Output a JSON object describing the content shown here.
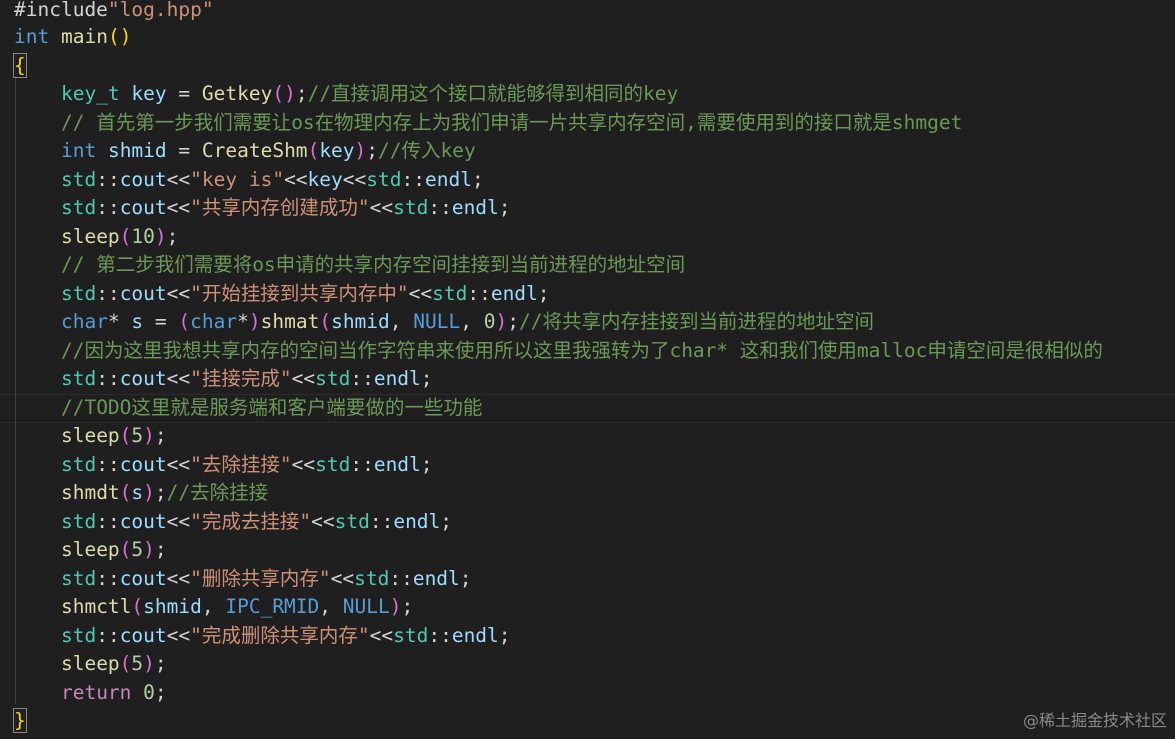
{
  "editor": {
    "lines": [
      [
        [
          "pun",
          "#include"
        ],
        [
          "str",
          "\"log.hpp\""
        ]
      ],
      [
        [
          "kw",
          "int"
        ],
        [
          "pun",
          " "
        ],
        [
          "fn",
          "main"
        ],
        [
          "brace",
          "()"
        ]
      ],
      [
        [
          "brace",
          "{"
        ]
      ],
      [],
      [
        [
          "pun",
          "    "
        ],
        [
          "type",
          "key_t"
        ],
        [
          "pun",
          " "
        ],
        [
          "var",
          "key"
        ],
        [
          "pun",
          " = "
        ],
        [
          "fn",
          "Getkey"
        ],
        [
          "paren",
          "()"
        ],
        [
          "pun",
          ";"
        ],
        [
          "cmt",
          "//直接调用这个接口就能够得到相同的key"
        ]
      ],
      [
        [
          "pun",
          "    "
        ],
        [
          "cmt",
          "// 首先第一步我们需要让os在物理内存上为我们申请一片共享内存空间,需要使用到的接口就是shmget"
        ]
      ],
      [
        [
          "pun",
          "    "
        ],
        [
          "kw",
          "int"
        ],
        [
          "pun",
          " "
        ],
        [
          "var",
          "shmid"
        ],
        [
          "pun",
          " = "
        ],
        [
          "fn",
          "CreateShm"
        ],
        [
          "paren",
          "("
        ],
        [
          "var",
          "key"
        ],
        [
          "paren",
          ")"
        ],
        [
          "pun",
          ";"
        ],
        [
          "cmt",
          "//传入key"
        ]
      ],
      [
        [
          "pun",
          "    "
        ],
        [
          "type",
          "std"
        ],
        [
          "pun",
          "::"
        ],
        [
          "var",
          "cout"
        ],
        [
          "pun",
          "<<"
        ],
        [
          "str",
          "\"key is\""
        ],
        [
          "pun",
          "<<"
        ],
        [
          "var",
          "key"
        ],
        [
          "pun",
          "<<"
        ],
        [
          "type",
          "std"
        ],
        [
          "pun",
          "::"
        ],
        [
          "var",
          "endl"
        ],
        [
          "pun",
          ";"
        ]
      ],
      [
        [
          "pun",
          "    "
        ],
        [
          "type",
          "std"
        ],
        [
          "pun",
          "::"
        ],
        [
          "var",
          "cout"
        ],
        [
          "pun",
          "<<"
        ],
        [
          "str",
          "\"共享内存创建成功\""
        ],
        [
          "pun",
          "<<"
        ],
        [
          "type",
          "std"
        ],
        [
          "pun",
          "::"
        ],
        [
          "var",
          "endl"
        ],
        [
          "pun",
          ";"
        ]
      ],
      [
        [
          "pun",
          "    "
        ],
        [
          "fn",
          "sleep"
        ],
        [
          "paren",
          "("
        ],
        [
          "num",
          "10"
        ],
        [
          "paren",
          ")"
        ],
        [
          "pun",
          ";"
        ]
      ],
      [
        [
          "pun",
          "    "
        ],
        [
          "cmt",
          "// 第二步我们需要将os申请的共享内存空间挂接到当前进程的地址空间"
        ]
      ],
      [
        [
          "pun",
          "    "
        ],
        [
          "type",
          "std"
        ],
        [
          "pun",
          "::"
        ],
        [
          "var",
          "cout"
        ],
        [
          "pun",
          "<<"
        ],
        [
          "str",
          "\"开始挂接到共享内存中\""
        ],
        [
          "pun",
          "<<"
        ],
        [
          "type",
          "std"
        ],
        [
          "pun",
          "::"
        ],
        [
          "var",
          "endl"
        ],
        [
          "pun",
          ";"
        ]
      ],
      [
        [
          "pun",
          "    "
        ],
        [
          "kw",
          "char"
        ],
        [
          "pun",
          "* "
        ],
        [
          "var",
          "s"
        ],
        [
          "pun",
          " = "
        ],
        [
          "paren",
          "("
        ],
        [
          "kw",
          "char"
        ],
        [
          "pun",
          "*"
        ],
        [
          "paren",
          ")"
        ],
        [
          "fn",
          "shmat"
        ],
        [
          "paren",
          "("
        ],
        [
          "var",
          "shmid"
        ],
        [
          "pun",
          ", "
        ],
        [
          "macro",
          "NULL"
        ],
        [
          "pun",
          ", "
        ],
        [
          "num",
          "0"
        ],
        [
          "paren",
          ")"
        ],
        [
          "pun",
          ";"
        ],
        [
          "cmt",
          "//将共享内存挂接到当前进程的地址空间"
        ]
      ],
      [
        [
          "pun",
          "    "
        ],
        [
          "cmt",
          "//因为这里我想共享内存的空间当作字符串来使用所以这里我强转为了char* 这和我们使用malloc申请空间是很相似的"
        ]
      ],
      [
        [
          "pun",
          "    "
        ],
        [
          "type",
          "std"
        ],
        [
          "pun",
          "::"
        ],
        [
          "var",
          "cout"
        ],
        [
          "pun",
          "<<"
        ],
        [
          "str",
          "\"挂接完成\""
        ],
        [
          "pun",
          "<<"
        ],
        [
          "type",
          "std"
        ],
        [
          "pun",
          "::"
        ],
        [
          "var",
          "endl"
        ],
        [
          "pun",
          ";"
        ]
      ],
      [
        [
          "pun",
          "    "
        ],
        [
          "cmt",
          "//TODO这里就是服务端和客户端要做的一些功能"
        ]
      ],
      [
        [
          "pun",
          "    "
        ],
        [
          "fn",
          "sleep"
        ],
        [
          "paren",
          "("
        ],
        [
          "num",
          "5"
        ],
        [
          "paren",
          ")"
        ],
        [
          "pun",
          ";"
        ]
      ],
      [
        [
          "pun",
          "    "
        ],
        [
          "type",
          "std"
        ],
        [
          "pun",
          "::"
        ],
        [
          "var",
          "cout"
        ],
        [
          "pun",
          "<<"
        ],
        [
          "str",
          "\"去除挂接\""
        ],
        [
          "pun",
          "<<"
        ],
        [
          "type",
          "std"
        ],
        [
          "pun",
          "::"
        ],
        [
          "var",
          "endl"
        ],
        [
          "pun",
          ";"
        ]
      ],
      [
        [
          "pun",
          "    "
        ],
        [
          "fn",
          "shmdt"
        ],
        [
          "paren",
          "("
        ],
        [
          "var",
          "s"
        ],
        [
          "paren",
          ")"
        ],
        [
          "pun",
          ";"
        ],
        [
          "cmt",
          "//去除挂接"
        ]
      ],
      [
        [
          "pun",
          "    "
        ],
        [
          "type",
          "std"
        ],
        [
          "pun",
          "::"
        ],
        [
          "var",
          "cout"
        ],
        [
          "pun",
          "<<"
        ],
        [
          "str",
          "\"完成去挂接\""
        ],
        [
          "pun",
          "<<"
        ],
        [
          "type",
          "std"
        ],
        [
          "pun",
          "::"
        ],
        [
          "var",
          "endl"
        ],
        [
          "pun",
          ";"
        ]
      ],
      [
        [
          "pun",
          "    "
        ],
        [
          "fn",
          "sleep"
        ],
        [
          "paren",
          "("
        ],
        [
          "num",
          "5"
        ],
        [
          "paren",
          ")"
        ],
        [
          "pun",
          ";"
        ]
      ],
      [
        [
          "pun",
          "    "
        ],
        [
          "type",
          "std"
        ],
        [
          "pun",
          "::"
        ],
        [
          "var",
          "cout"
        ],
        [
          "pun",
          "<<"
        ],
        [
          "str",
          "\"删除共享内存\""
        ],
        [
          "pun",
          "<<"
        ],
        [
          "type",
          "std"
        ],
        [
          "pun",
          "::"
        ],
        [
          "var",
          "endl"
        ],
        [
          "pun",
          ";"
        ]
      ],
      [
        [
          "pun",
          "    "
        ],
        [
          "fn",
          "shmctl"
        ],
        [
          "paren",
          "("
        ],
        [
          "var",
          "shmid"
        ],
        [
          "pun",
          ", "
        ],
        [
          "macro",
          "IPC_RMID"
        ],
        [
          "pun",
          ", "
        ],
        [
          "macro",
          "NULL"
        ],
        [
          "paren",
          ")"
        ],
        [
          "pun",
          ";"
        ]
      ],
      [
        [
          "pun",
          "    "
        ],
        [
          "type",
          "std"
        ],
        [
          "pun",
          "::"
        ],
        [
          "var",
          "cout"
        ],
        [
          "pun",
          "<<"
        ],
        [
          "str",
          "\"完成删除共享内存\""
        ],
        [
          "pun",
          "<<"
        ],
        [
          "type",
          "std"
        ],
        [
          "pun",
          "::"
        ],
        [
          "var",
          "endl"
        ],
        [
          "pun",
          ";"
        ]
      ],
      [
        [
          "pun",
          "    "
        ],
        [
          "fn",
          "sleep"
        ],
        [
          "paren",
          "("
        ],
        [
          "num",
          "5"
        ],
        [
          "paren",
          ")"
        ],
        [
          "pun",
          ";"
        ]
      ],
      [
        [
          "pun",
          "    "
        ],
        [
          "ret",
          "return"
        ],
        [
          "pun",
          " "
        ],
        [
          "num",
          "0"
        ],
        [
          "pun",
          ";"
        ]
      ],
      [
        [
          "brace",
          "}"
        ]
      ]
    ]
  },
  "watermark": "@稀土掘金技术社区"
}
